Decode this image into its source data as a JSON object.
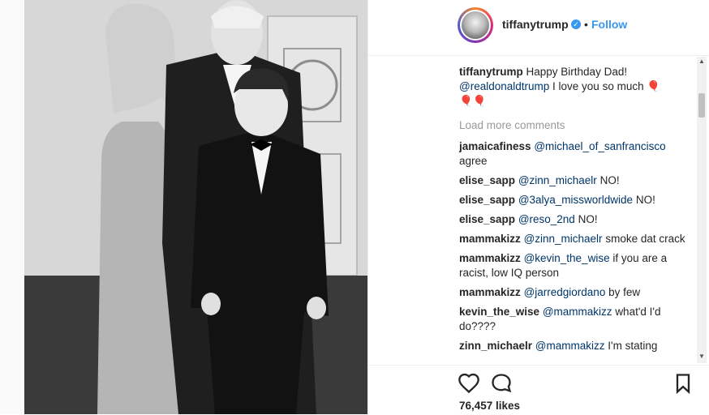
{
  "post": {
    "account": {
      "username": "tiffanytrump",
      "verified_badge": "✓",
      "separator": "•",
      "follow_label": "Follow"
    },
    "caption": {
      "username": "tiffanytrump",
      "text_1": "Happy Birthday Dad!",
      "mention": "@realdonaldtrump",
      "text_2": "I love you so much",
      "emoji_1": "🎈",
      "emoji_2": "🎈🎈"
    },
    "load_more_label": "Load more comments",
    "comments": [
      {
        "user": "jamaicafiness",
        "mention": "@michael_of_sanfrancisco",
        "text": "agree"
      },
      {
        "user": "elise_sapp",
        "mention": "@zinn_michaelr",
        "text": "NO!"
      },
      {
        "user": "elise_sapp",
        "mention": "@3alya_missworldwide",
        "text": "NO!"
      },
      {
        "user": "elise_sapp",
        "mention": "@reso_2nd",
        "text": "NO!"
      },
      {
        "user": "mammakizz",
        "mention": "@zinn_michaelr",
        "text": "smoke dat crack"
      },
      {
        "user": "mammakizz",
        "mention": "@kevin_the_wise",
        "text": "if you are a racist, low IQ person"
      },
      {
        "user": "mammakizz",
        "mention": "@jarredgiordano",
        "text": "by few"
      },
      {
        "user": "kevin_the_wise",
        "mention": "@mammakizz",
        "text": "what'd I'd do????"
      },
      {
        "user": "zinn_michaelr",
        "mention": "@mammakizz",
        "text": "I'm stating"
      }
    ],
    "likes_label": "76,457 likes",
    "icons": {
      "like": "heart-outline-icon",
      "comment": "speech-bubble-icon",
      "save": "bookmark-icon"
    },
    "colors": {
      "link": "#3897f0",
      "mention": "#003569",
      "muted": "#999999"
    }
  }
}
